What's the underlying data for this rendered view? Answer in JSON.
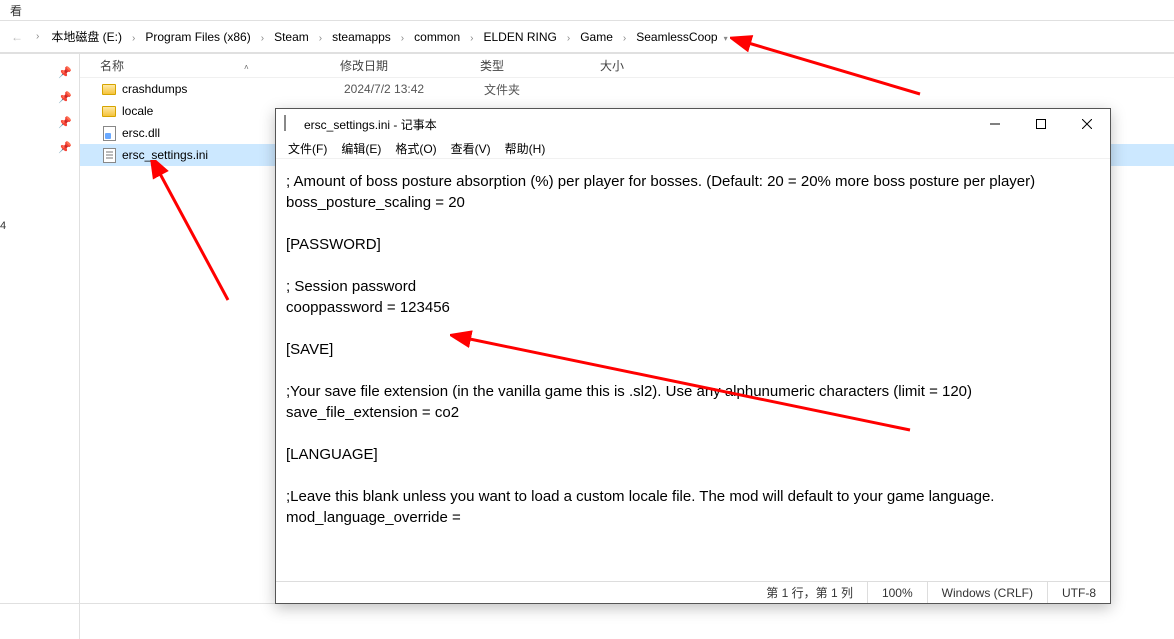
{
  "explorer_header": "看",
  "breadcrumb": [
    "本地磁盘 (E:)",
    "Program Files (x86)",
    "Steam",
    "steamapps",
    "common",
    "ELDEN RING",
    "Game",
    "SeamlessCoop"
  ],
  "columns": {
    "name": "名称",
    "date": "修改日期",
    "type": "类型",
    "size": "大小"
  },
  "files": [
    {
      "name": "crashdumps",
      "date": "2024/7/2 13:42",
      "type": "文件夹",
      "icon": "folder"
    },
    {
      "name": "locale",
      "date": "",
      "type": "",
      "icon": "folder"
    },
    {
      "name": "ersc.dll",
      "date": "",
      "type": "",
      "icon": "dll"
    },
    {
      "name": "ersc_settings.ini",
      "date": "",
      "type": "",
      "icon": "ini",
      "selected": true
    }
  ],
  "left_marker": "4",
  "notepad": {
    "title": "ersc_settings.ini - 记事本",
    "menus": [
      "文件(F)",
      "编辑(E)",
      "格式(O)",
      "查看(V)",
      "帮助(H)"
    ],
    "content": "; Amount of boss posture absorption (%) per player for bosses. (Default: 20 = 20% more boss posture per player)\nboss_posture_scaling = 20\n\n[PASSWORD]\n\n; Session password\ncooppassword = 123456\n\n[SAVE]\n\n;Your save file extension (in the vanilla game this is .sl2). Use any alphunumeric characters (limit = 120)\nsave_file_extension = co2\n\n[LANGUAGE]\n\n;Leave this blank unless you want to load a custom locale file. The mod will default to your game language.\nmod_language_override =",
    "status": {
      "pos": "第 1 行，第 1 列",
      "zoom": "100%",
      "eol": "Windows (CRLF)",
      "enc": "UTF-8"
    }
  }
}
